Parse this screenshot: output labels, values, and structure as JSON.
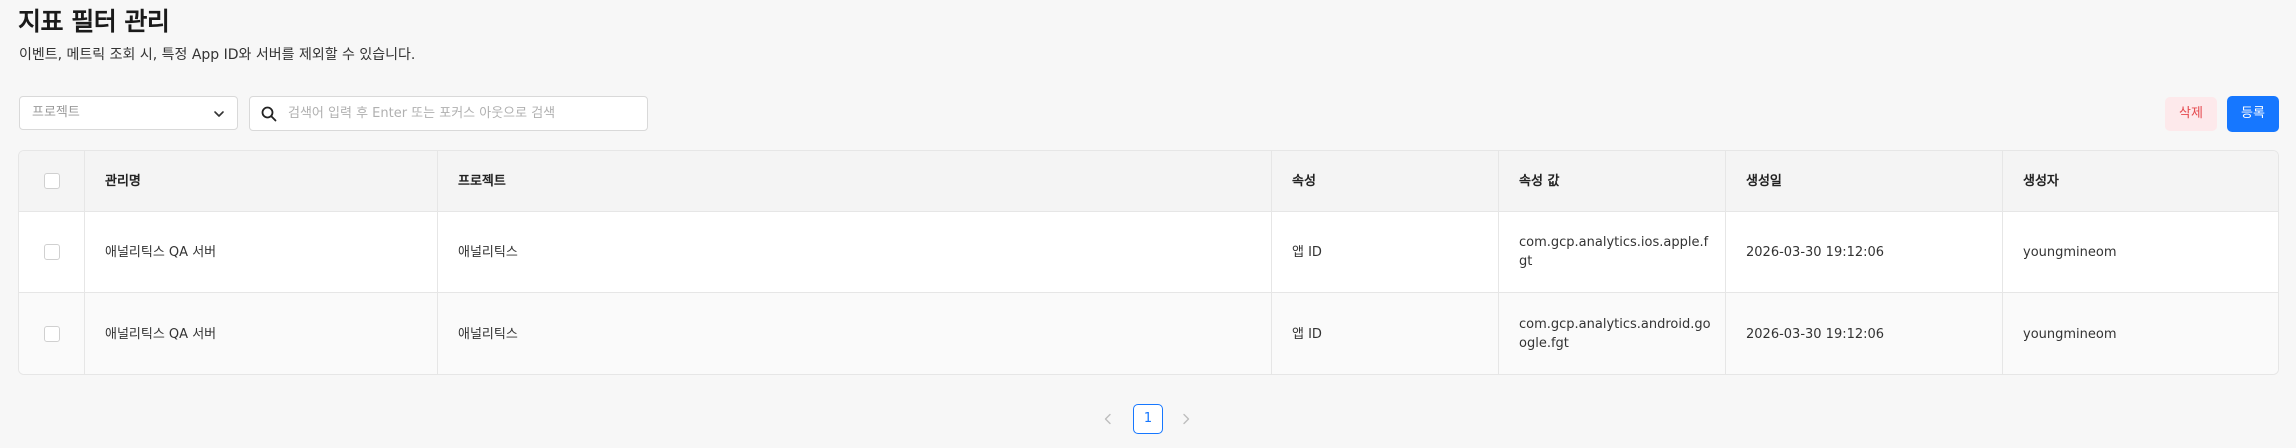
{
  "page": {
    "title": "지표 필터 관리",
    "description": "이벤트, 메트릭 조회 시, 특정 App ID와 서버를 제외할 수 있습니다."
  },
  "filters": {
    "project_placeholder": "프로젝트",
    "search_placeholder": "검색어 입력 후 Enter 또는 포커스 아웃으로 검색",
    "search_value": ""
  },
  "actions": {
    "delete_label": "삭제",
    "register_label": "등록"
  },
  "table": {
    "columns": [
      "관리명",
      "프로젝트",
      "속성",
      "속성 값",
      "생성일",
      "생성자"
    ],
    "rows": [
      [
        "애널리틱스 QA 서버",
        "애널리틱스",
        "앱 ID",
        "com.gcp.analytics.ios.apple.fgt",
        "2026-03-30 19:12:06",
        "youngmineom"
      ],
      [
        "애널리틱스 QA 서버",
        "애널리틱스",
        "앱 ID",
        "com.gcp.analytics.android.google.fgt",
        "2026-03-30 19:12:06",
        "youngmineom"
      ]
    ]
  },
  "pagination": {
    "current_page": "1"
  },
  "colors": {
    "primary": "#1677ff",
    "danger": "#e5484d",
    "danger_bg": "#fde9eb",
    "background": "#f7f7f7",
    "header_bg": "#f4f4f4",
    "border": "#e6e6e6"
  },
  "icons": {
    "dropdown": "chevron-down-icon",
    "search": "search-icon",
    "prev": "chevron-left-icon",
    "next": "chevron-right-icon"
  }
}
